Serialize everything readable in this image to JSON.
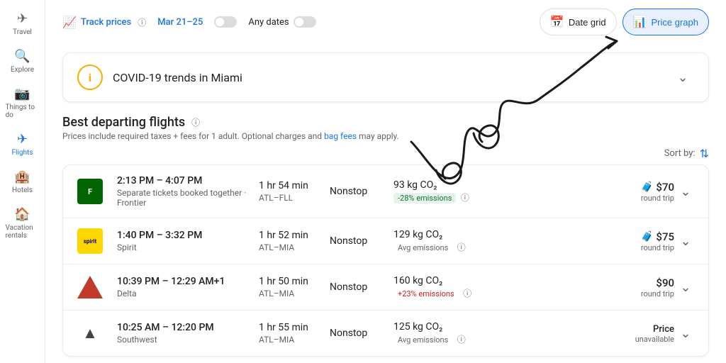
{
  "sidebar": {
    "items": [
      {
        "label": "Travel",
        "icon": "✈",
        "active": false
      },
      {
        "label": "Explore",
        "icon": "🔍",
        "active": false
      },
      {
        "label": "Things to do",
        "icon": "📷",
        "active": false
      },
      {
        "label": "Flights",
        "icon": "✈",
        "active": true
      },
      {
        "label": "Hotels",
        "icon": "🏨",
        "active": false
      },
      {
        "label": "Vacation rentals",
        "icon": "🏠",
        "active": false
      }
    ]
  },
  "toolbar": {
    "track_prices_label": "Track prices",
    "date_range": "Mar 21–25",
    "any_dates_label": "Any dates",
    "date_grid_label": "Date grid",
    "price_graph_label": "Price graph"
  },
  "covid_banner": {
    "title": "COVID-19 trends in Miami"
  },
  "flights_section": {
    "title": "Best departing flights",
    "subtitle": "Prices include required taxes + fees for 1 adult. Optional charges and",
    "bag_fees_link": "bag fees",
    "subtitle_end": "may apply.",
    "sort_by_label": "Sort by:",
    "flights": [
      {
        "airline": "Frontier",
        "airline_type": "frontier",
        "time": "2:13 PM – 4:07 PM",
        "carrier_note": "Separate tickets booked together · Frontier",
        "duration": "1 hr 54 min",
        "route": "ATL–FLL",
        "stops": "Nonstop",
        "emissions": "93 kg CO₂",
        "emissions_badge": "-28% emissions",
        "emissions_type": "low",
        "price": "$70",
        "price_sub": "round trip",
        "has_luggage": true,
        "unavailable": false
      },
      {
        "airline": "Spirit",
        "airline_type": "spirit",
        "time": "1:40 PM – 3:32 PM",
        "carrier_note": "Spirit",
        "duration": "1 hr 52 min",
        "route": "ATL–MIA",
        "stops": "Nonstop",
        "emissions": "129 kg CO₂",
        "emissions_badge": "Avg emissions",
        "emissions_type": "avg",
        "price": "$75",
        "price_sub": "round trip",
        "has_luggage": true,
        "unavailable": false
      },
      {
        "airline": "Delta",
        "airline_type": "delta",
        "time": "10:39 PM – 12:29 AM+1",
        "carrier_note": "Delta",
        "duration": "1 hr 50 min",
        "route": "ATL–MIA",
        "stops": "Nonstop",
        "emissions": "160 kg CO₂",
        "emissions_badge": "+23% emissions",
        "emissions_type": "high",
        "price": "$90",
        "price_sub": "round trip",
        "has_luggage": false,
        "unavailable": false
      },
      {
        "airline": "Southwest",
        "airline_type": "southwest",
        "time": "10:25 AM – 12:20 PM",
        "carrier_note": "Southwest",
        "duration": "1 hr 55 min",
        "route": "ATL–MIA",
        "stops": "Nonstop",
        "emissions": "125 kg CO₂",
        "emissions_badge": "Avg emissions",
        "emissions_type": "avg",
        "price": "Price",
        "price_sub": "unavailable",
        "has_luggage": false,
        "unavailable": true
      }
    ]
  }
}
